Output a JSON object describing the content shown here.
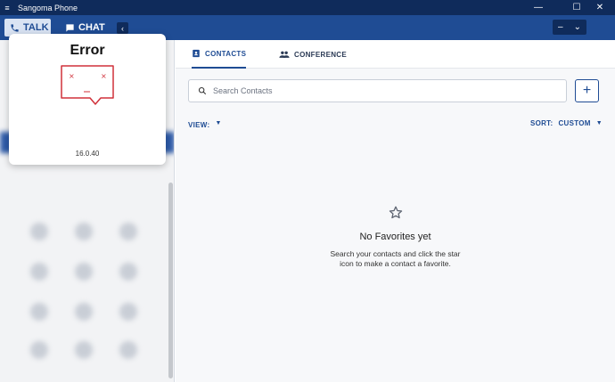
{
  "window": {
    "title": "Sangoma Phone",
    "minimize": "—",
    "maximize": "☐",
    "close": "✕"
  },
  "topbar": {
    "talk_label": "TALK",
    "chat_label": "CHAT",
    "collapse_glyph": "‹",
    "status_value": "–"
  },
  "popup": {
    "title": "Error",
    "version": "16.0.40"
  },
  "tabs": [
    {
      "label": "CONTACTS",
      "active": true
    },
    {
      "label": "CONFERENCE",
      "active": false
    }
  ],
  "search": {
    "placeholder": "Search Contacts",
    "value": ""
  },
  "add_glyph": "+",
  "view": {
    "label": "VIEW:",
    "value": ""
  },
  "sort": {
    "label": "SORT:",
    "value": "CUSTOM"
  },
  "empty_state": {
    "heading": "No Favorites yet",
    "body": "Search your contacts and click the star icon to make a contact a favorite."
  },
  "colors": {
    "titlebar": "#0f2b5b",
    "topbar": "#1f4c94",
    "accent": "#1f4c94",
    "error": "#d0303a"
  }
}
